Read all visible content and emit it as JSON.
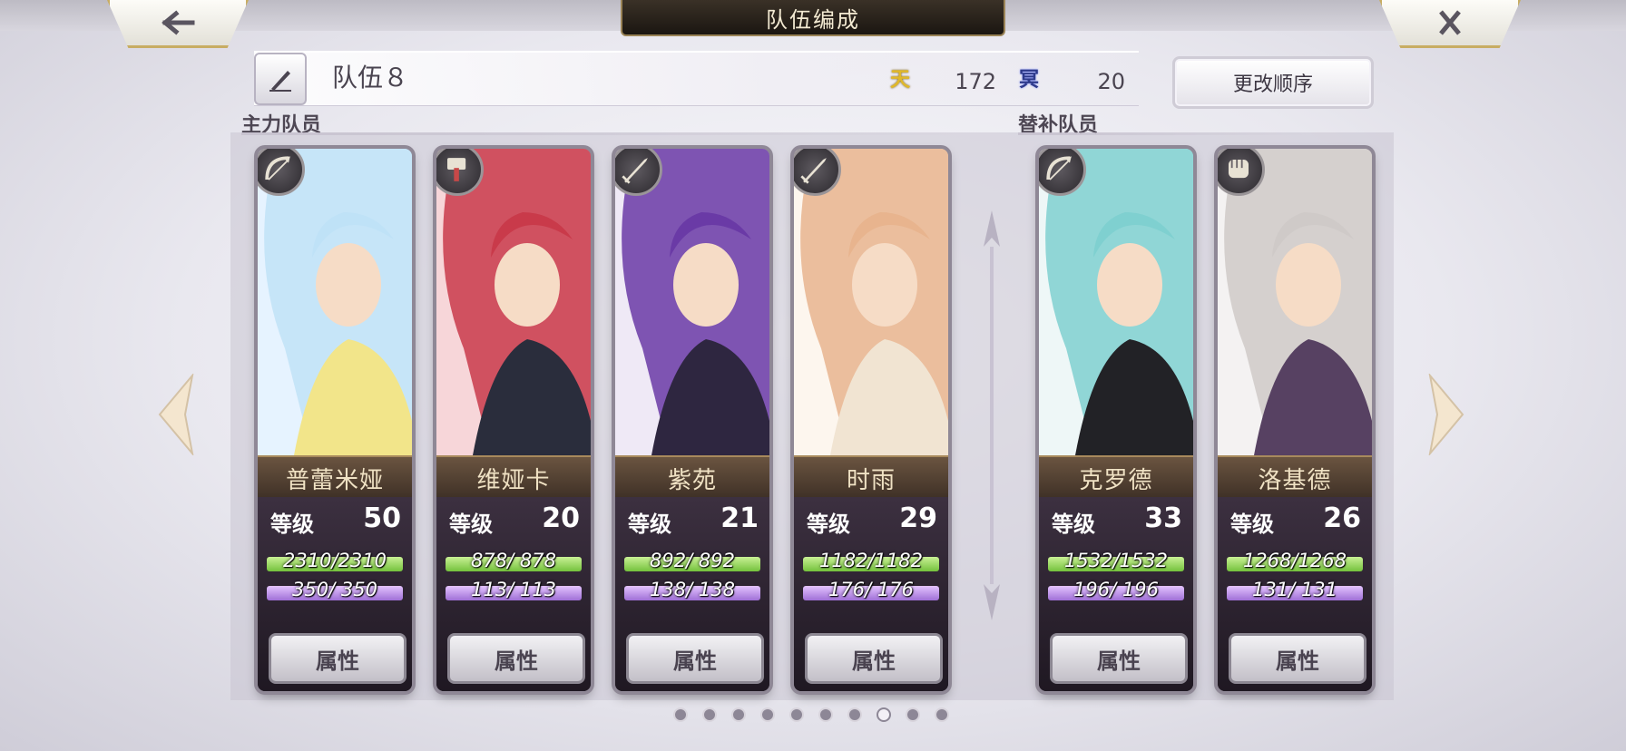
{
  "header": {
    "title": "队伍编成"
  },
  "team": {
    "name": "队伍８",
    "currency_1": {
      "icon": "天",
      "value": "172"
    },
    "currency_2": {
      "icon": "冥",
      "value": "20"
    },
    "reorder_label": "更改顺序"
  },
  "sections": {
    "main": "主力队员",
    "reserve": "替补队员"
  },
  "members": [
    {
      "name": "普蕾米娅",
      "level_label": "等级",
      "level": "50",
      "hp": "2310/2310",
      "mp": "350/ 350",
      "button": "属性",
      "icon": "bow-icon",
      "colors": [
        "#e6f3ff",
        "#bfe2f7",
        "#f2e58a"
      ]
    },
    {
      "name": "维娅卡",
      "level_label": "等级",
      "level": "20",
      "hp": "878/ 878",
      "mp": "113/ 113",
      "button": "属性",
      "icon": "hammer-icon",
      "colors": [
        "#f7d6d9",
        "#c93a4a",
        "#2a2d3c"
      ]
    },
    {
      "name": "紫苑",
      "level_label": "等级",
      "level": "21",
      "hp": "892/ 892",
      "mp": "138/ 138",
      "button": "属性",
      "icon": "sword-icon",
      "colors": [
        "#efe9f6",
        "#6a3aa6",
        "#2e2640"
      ]
    },
    {
      "name": "时雨",
      "level_label": "等级",
      "level": "29",
      "hp": "1182/1182",
      "mp": "176/ 176",
      "button": "属性",
      "icon": "sword-icon",
      "colors": [
        "#fdf6ee",
        "#e8b48e",
        "#f1e4d2"
      ]
    },
    {
      "name": "克罗德",
      "level_label": "等级",
      "level": "33",
      "hp": "1532/1532",
      "mp": "196/ 196",
      "button": "属性",
      "icon": "bow-icon",
      "colors": [
        "#eef7f7",
        "#7fd0d0",
        "#222226"
      ]
    },
    {
      "name": "洛基德",
      "level_label": "等级",
      "level": "26",
      "hp": "1268/1268",
      "mp": "131/ 131",
      "button": "属性",
      "icon": "fist-icon",
      "colors": [
        "#f4f2f2",
        "#cfcac8",
        "#574162"
      ]
    }
  ],
  "pagination": {
    "total": 10,
    "active": 8
  },
  "accent_color": "#c8ad62"
}
